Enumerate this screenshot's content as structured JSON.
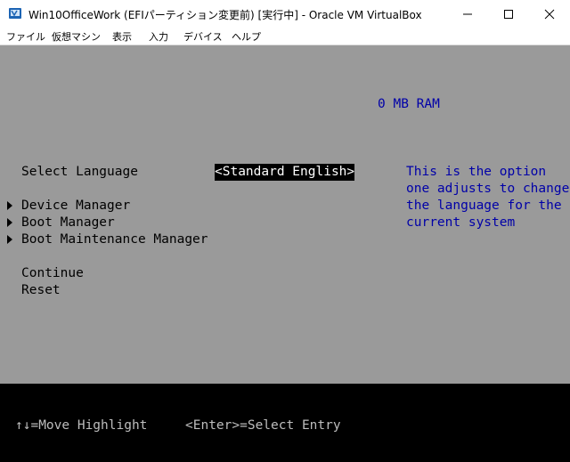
{
  "window": {
    "title": "Win10OfficeWork (EFIパーティション変更前) [実行中] - Oracle VM VirtualBox",
    "icon": "virtualbox-icon",
    "controls": [
      "minimize-icon",
      "maximize-icon",
      "close-icon"
    ]
  },
  "menu": {
    "items": [
      "ファイル",
      "仮想マシン",
      "表示",
      "入力",
      "デバイス",
      "ヘルプ"
    ]
  },
  "bios": {
    "ram": "0 MB RAM",
    "select_language_label": "Select Language",
    "language_value": "<Standard English>",
    "menu_items": [
      "Device Manager",
      "Boot Manager",
      "Boot Maintenance Manager"
    ],
    "continue": "Continue",
    "reset": "Reset",
    "help_lines": [
      "This is the option",
      "one adjusts to change",
      "the language for the",
      "current system"
    ],
    "footer": {
      "move": "↑↓=Move Highlight",
      "enter": "<Enter>=Select Entry"
    },
    "colors": {
      "background": "#9a9a9a",
      "help_text": "#0000a8",
      "footer_bg": "#000000"
    }
  }
}
